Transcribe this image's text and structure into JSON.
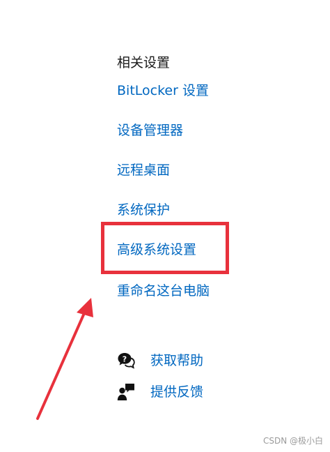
{
  "related_settings": {
    "title": "相关设置",
    "links": {
      "bitlocker": "BitLocker 设置",
      "device_manager": "设备管理器",
      "remote_desktop": "远程桌面",
      "system_protection": "系统保护",
      "advanced_system_settings": "高级系统设置",
      "rename_pc": "重命名这台电脑"
    }
  },
  "help": {
    "get_help": "获取帮助",
    "give_feedback": "提供反馈"
  },
  "annotation": {
    "highlight_color": "#e8313c",
    "arrow_color": "#e8313c"
  },
  "colors": {
    "link": "#0067c0",
    "text": "#1a1a1a"
  },
  "icons": {
    "get_help": "chat-help-icon",
    "give_feedback": "person-feedback-icon"
  },
  "watermark": "CSDN @极小白"
}
